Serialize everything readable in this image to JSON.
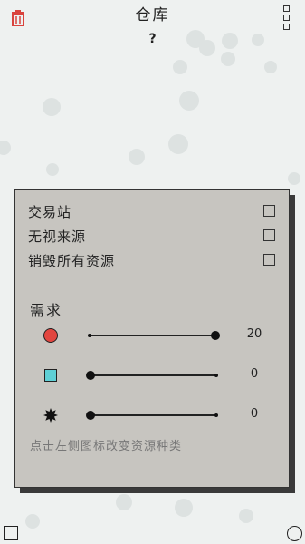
{
  "header": {
    "title": "仓库",
    "count": "?"
  },
  "panel": {
    "options": [
      {
        "label": "交易站",
        "checked": false
      },
      {
        "label": "无视来源",
        "checked": false
      },
      {
        "label": "销毁所有资源",
        "checked": false
      }
    ],
    "demand_title": "需求",
    "sliders": [
      {
        "resource": "red-circle",
        "value": "20",
        "level": 1.0
      },
      {
        "resource": "cyan-square",
        "value": "0",
        "level": 0.0
      },
      {
        "resource": "dark-gear",
        "value": "0",
        "level": 0.0
      }
    ],
    "hint": "点击左侧图标改变资源种类"
  },
  "colors": {
    "red": "#e2463f",
    "cyan": "#5fd0d6",
    "trash": "#d9433d",
    "panel": "#c7c5c0"
  },
  "icons": {
    "top_left": "trash-icon",
    "top_right": "menu-icon",
    "bottom_left": "square-icon",
    "bottom_right": "circle-icon"
  }
}
